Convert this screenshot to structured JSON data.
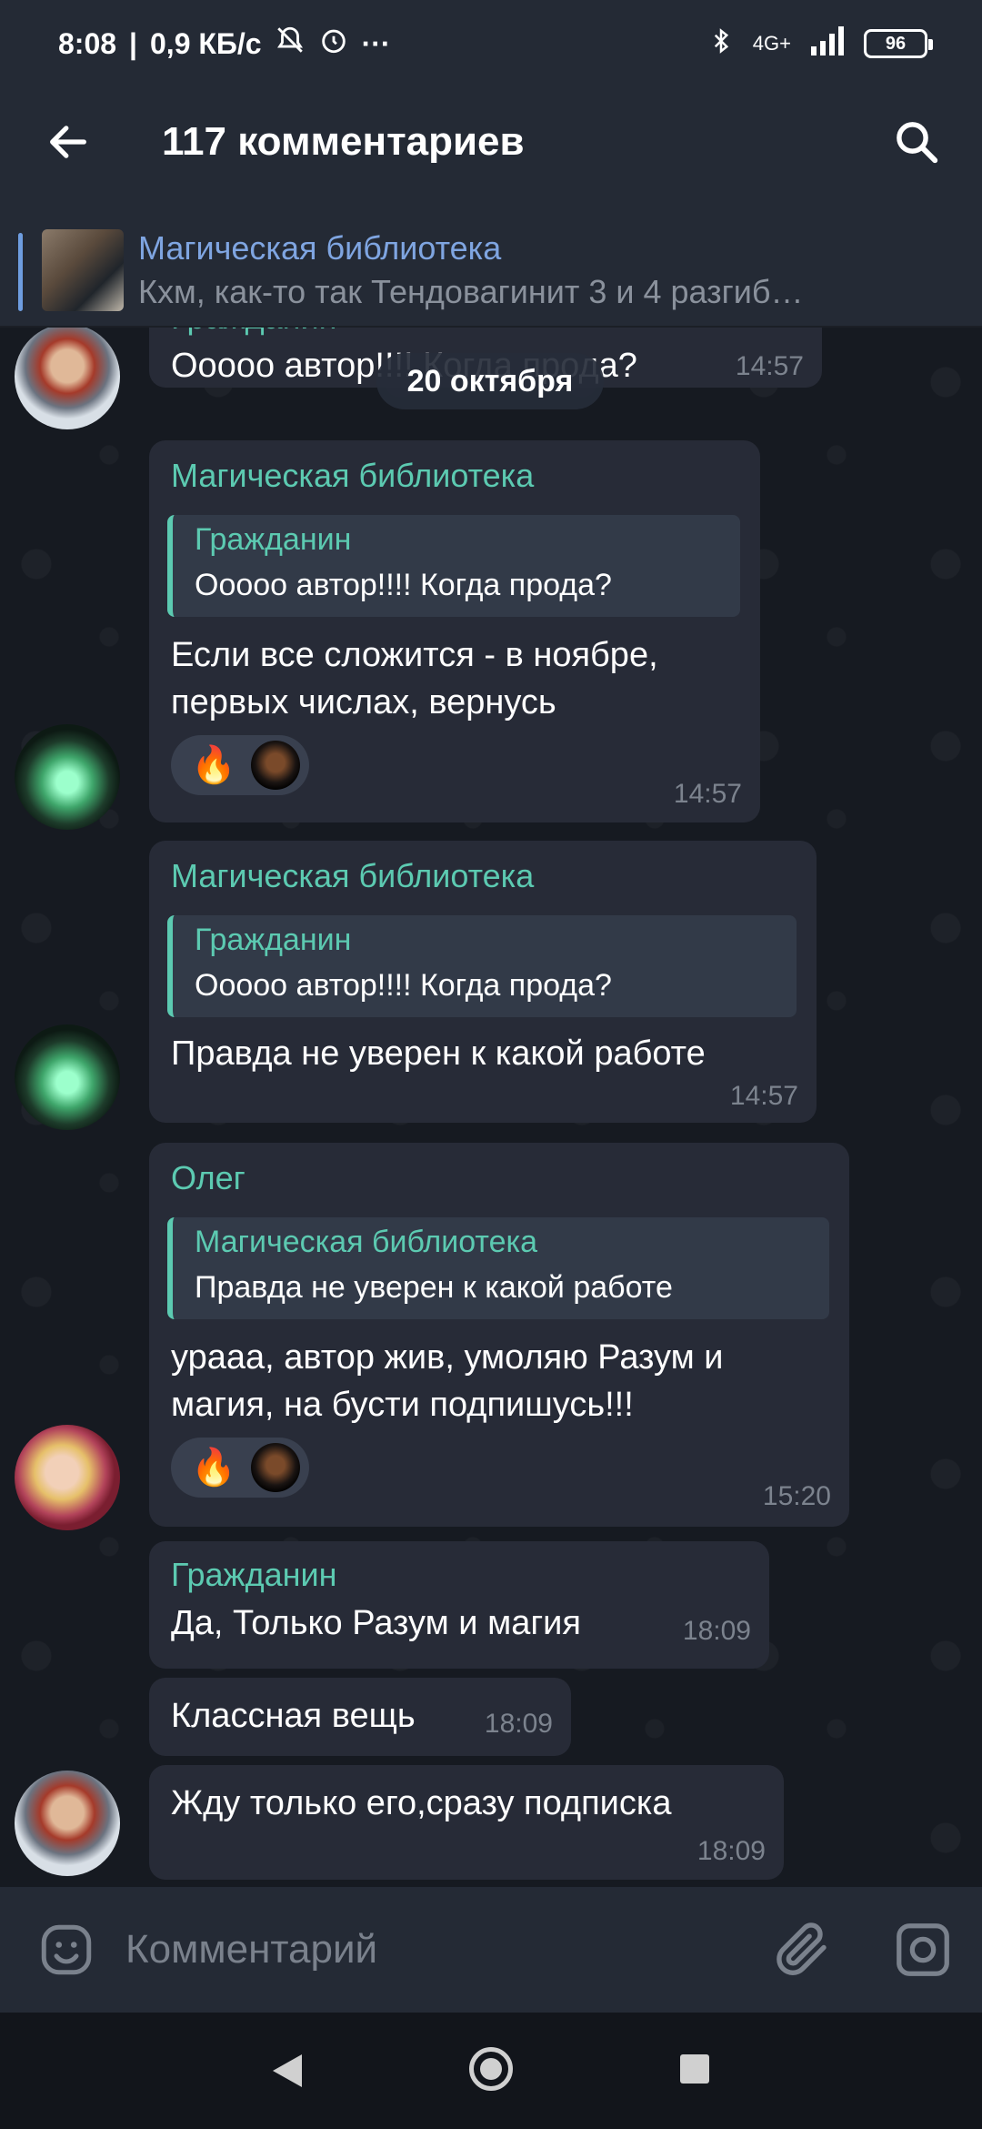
{
  "status_bar": {
    "time": "8:08",
    "speed": "0,9 КБ/с",
    "more": "···",
    "network": "4G+",
    "battery": "96"
  },
  "header": {
    "title": "117 комментариев"
  },
  "pinned": {
    "name": "Магическая библиотека",
    "text": "Кхм, как-то так Тендовагинит 3 и 4 разгиб…"
  },
  "date_pill": "20 октября",
  "messages": [
    {
      "sender": "Гражданин",
      "text": "Ооооо автор!!!! Когда прода?",
      "time": "14:57"
    },
    {
      "sender": "Магическая библиотека",
      "reply_name": "Гражданин",
      "reply_text": "Ооооо автор!!!! Когда прода?",
      "text_line1": "Если все сложится - в ноябре,",
      "text_line2": "первых числах, вернусь",
      "reaction": "🔥",
      "time": "14:57"
    },
    {
      "sender": "Магическая библиотека",
      "reply_name": "Гражданин",
      "reply_text": "Ооооо автор!!!! Когда прода?",
      "text": "Правда не уверен к какой работе",
      "time": "14:57"
    },
    {
      "sender": "Олег",
      "reply_name": "Магическая библиотека",
      "reply_text": "Правда не уверен к какой работе",
      "text_line1": "урааа, автор жив, умоляю Разум и",
      "text_line2": "магия, на бусти подпишусь!!!",
      "reaction": "🔥",
      "time": "15:20"
    },
    {
      "sender": "Гражданин",
      "text": "Да, Только Разум и магия",
      "time": "18:09"
    },
    {
      "text": "Классная вещь",
      "time": "18:09"
    },
    {
      "text": "Жду только его,сразу подписка",
      "time": "18:09"
    }
  ],
  "input": {
    "placeholder": "Комментарий"
  },
  "colors": {
    "accent": "#5ccab1",
    "link": "#7fa5e1",
    "bubble": "#272b37",
    "background": "#161a21"
  }
}
